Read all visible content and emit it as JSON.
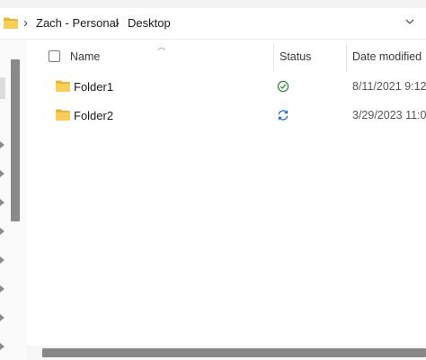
{
  "address_bar": {
    "breadcrumbs": [
      "Zach - Personal",
      "Desktop"
    ],
    "icons": [
      "folder-icon",
      "chevron-right-icon",
      "chevron-down-icon"
    ]
  },
  "columns": {
    "name": "Name",
    "status": "Status",
    "date_modified": "Date modified"
  },
  "files": [
    {
      "name": "Folder1",
      "status": "synced-check-icon",
      "date_modified": "8/11/2021 9:12"
    },
    {
      "name": "Folder2",
      "status": "sync-pending-icon",
      "date_modified": "3/29/2023 11:0"
    }
  ],
  "colors": {
    "folder": "#f2c94c",
    "status_synced": "#2e8b3a",
    "status_syncing": "#1f6fc2",
    "scrollbar": "#878787"
  }
}
